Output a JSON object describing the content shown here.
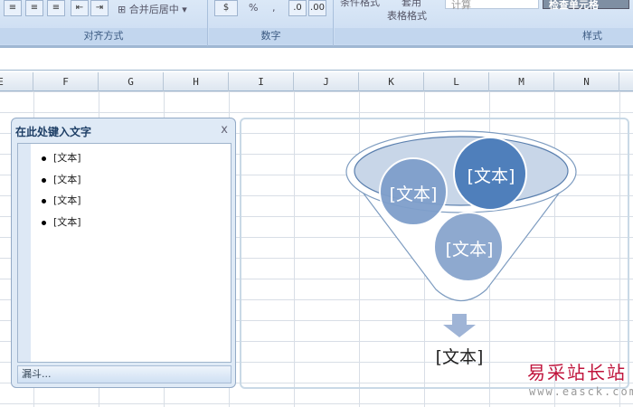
{
  "ribbon": {
    "merge_center": "合并后居中",
    "percent": "%",
    "comma": ",",
    "cond_format": "条件格式",
    "table_format_top": "套用",
    "table_format": "表格格式",
    "calc": "计算",
    "check_cell": "检查单元格",
    "groups": {
      "alignment": "对齐方式",
      "number": "数字",
      "styles": "样式"
    }
  },
  "columns": [
    "E",
    "F",
    "G",
    "H",
    "I",
    "J",
    "K",
    "L",
    "M",
    "N"
  ],
  "text_pane": {
    "title": "在此处键入文字",
    "close": "x",
    "items": [
      "[文本]",
      "[文本]",
      "[文本]",
      "[文本]"
    ],
    "footer": "漏斗..."
  },
  "smartart": {
    "circles": [
      "[文本]",
      "[文本]",
      "[文本]"
    ],
    "result": "[文本]"
  },
  "watermark": {
    "name": "易采站长站",
    "url": "www.easck.com"
  }
}
